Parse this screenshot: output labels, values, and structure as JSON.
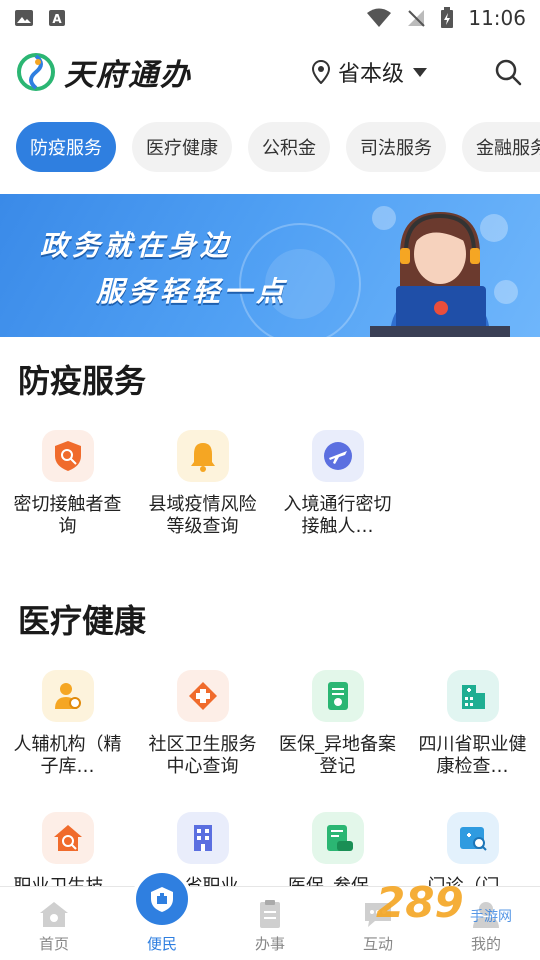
{
  "status_bar": {
    "time": "11:06"
  },
  "header": {
    "app_name": "天府通办",
    "location": "省本级"
  },
  "tabs": [
    {
      "label": "防疫服务",
      "active": true
    },
    {
      "label": "医疗健康",
      "active": false
    },
    {
      "label": "公积金",
      "active": false
    },
    {
      "label": "司法服务",
      "active": false
    },
    {
      "label": "金融服务",
      "active": false
    }
  ],
  "banner": {
    "line1": "政务就在身边",
    "line2": "服务轻轻一点"
  },
  "sections": [
    {
      "title": "防疫服务",
      "items": [
        {
          "label": "密切接触者查询",
          "icon": "shield-search-icon"
        },
        {
          "label": "县域疫情风险等级查询",
          "icon": "bell-alert-icon"
        },
        {
          "label": "入境通行密切接触人…",
          "icon": "airplane-icon"
        }
      ]
    },
    {
      "title": "医疗健康",
      "items": [
        {
          "label": "人辅机构（精子库…",
          "icon": "doctor-search-icon"
        },
        {
          "label": "社区卫生服务中心查询",
          "icon": "medical-cross-icon"
        },
        {
          "label": "医保_异地备案登记",
          "icon": "document-icon"
        },
        {
          "label": "四川省职业健康检查…",
          "icon": "hospital-icon"
        },
        {
          "label": "职业卫生技…",
          "icon": "house-search-icon"
        },
        {
          "label": "四川省职业…",
          "icon": "building-icon"
        },
        {
          "label": "医保_参保…",
          "icon": "insurance-card-icon"
        },
        {
          "label": "门诊（门…",
          "icon": "calendar-search-icon"
        }
      ]
    }
  ],
  "bottom_nav": [
    {
      "label": "首页",
      "active": false
    },
    {
      "label": "便民",
      "active": true
    },
    {
      "label": "办事",
      "active": false
    },
    {
      "label": "互动",
      "active": false
    },
    {
      "label": "我的",
      "active": false
    }
  ],
  "watermark": {
    "text": "289",
    "sub": "手游网"
  },
  "colors": {
    "accent": "#2f7fe0",
    "banner": "#4f9ff3"
  }
}
